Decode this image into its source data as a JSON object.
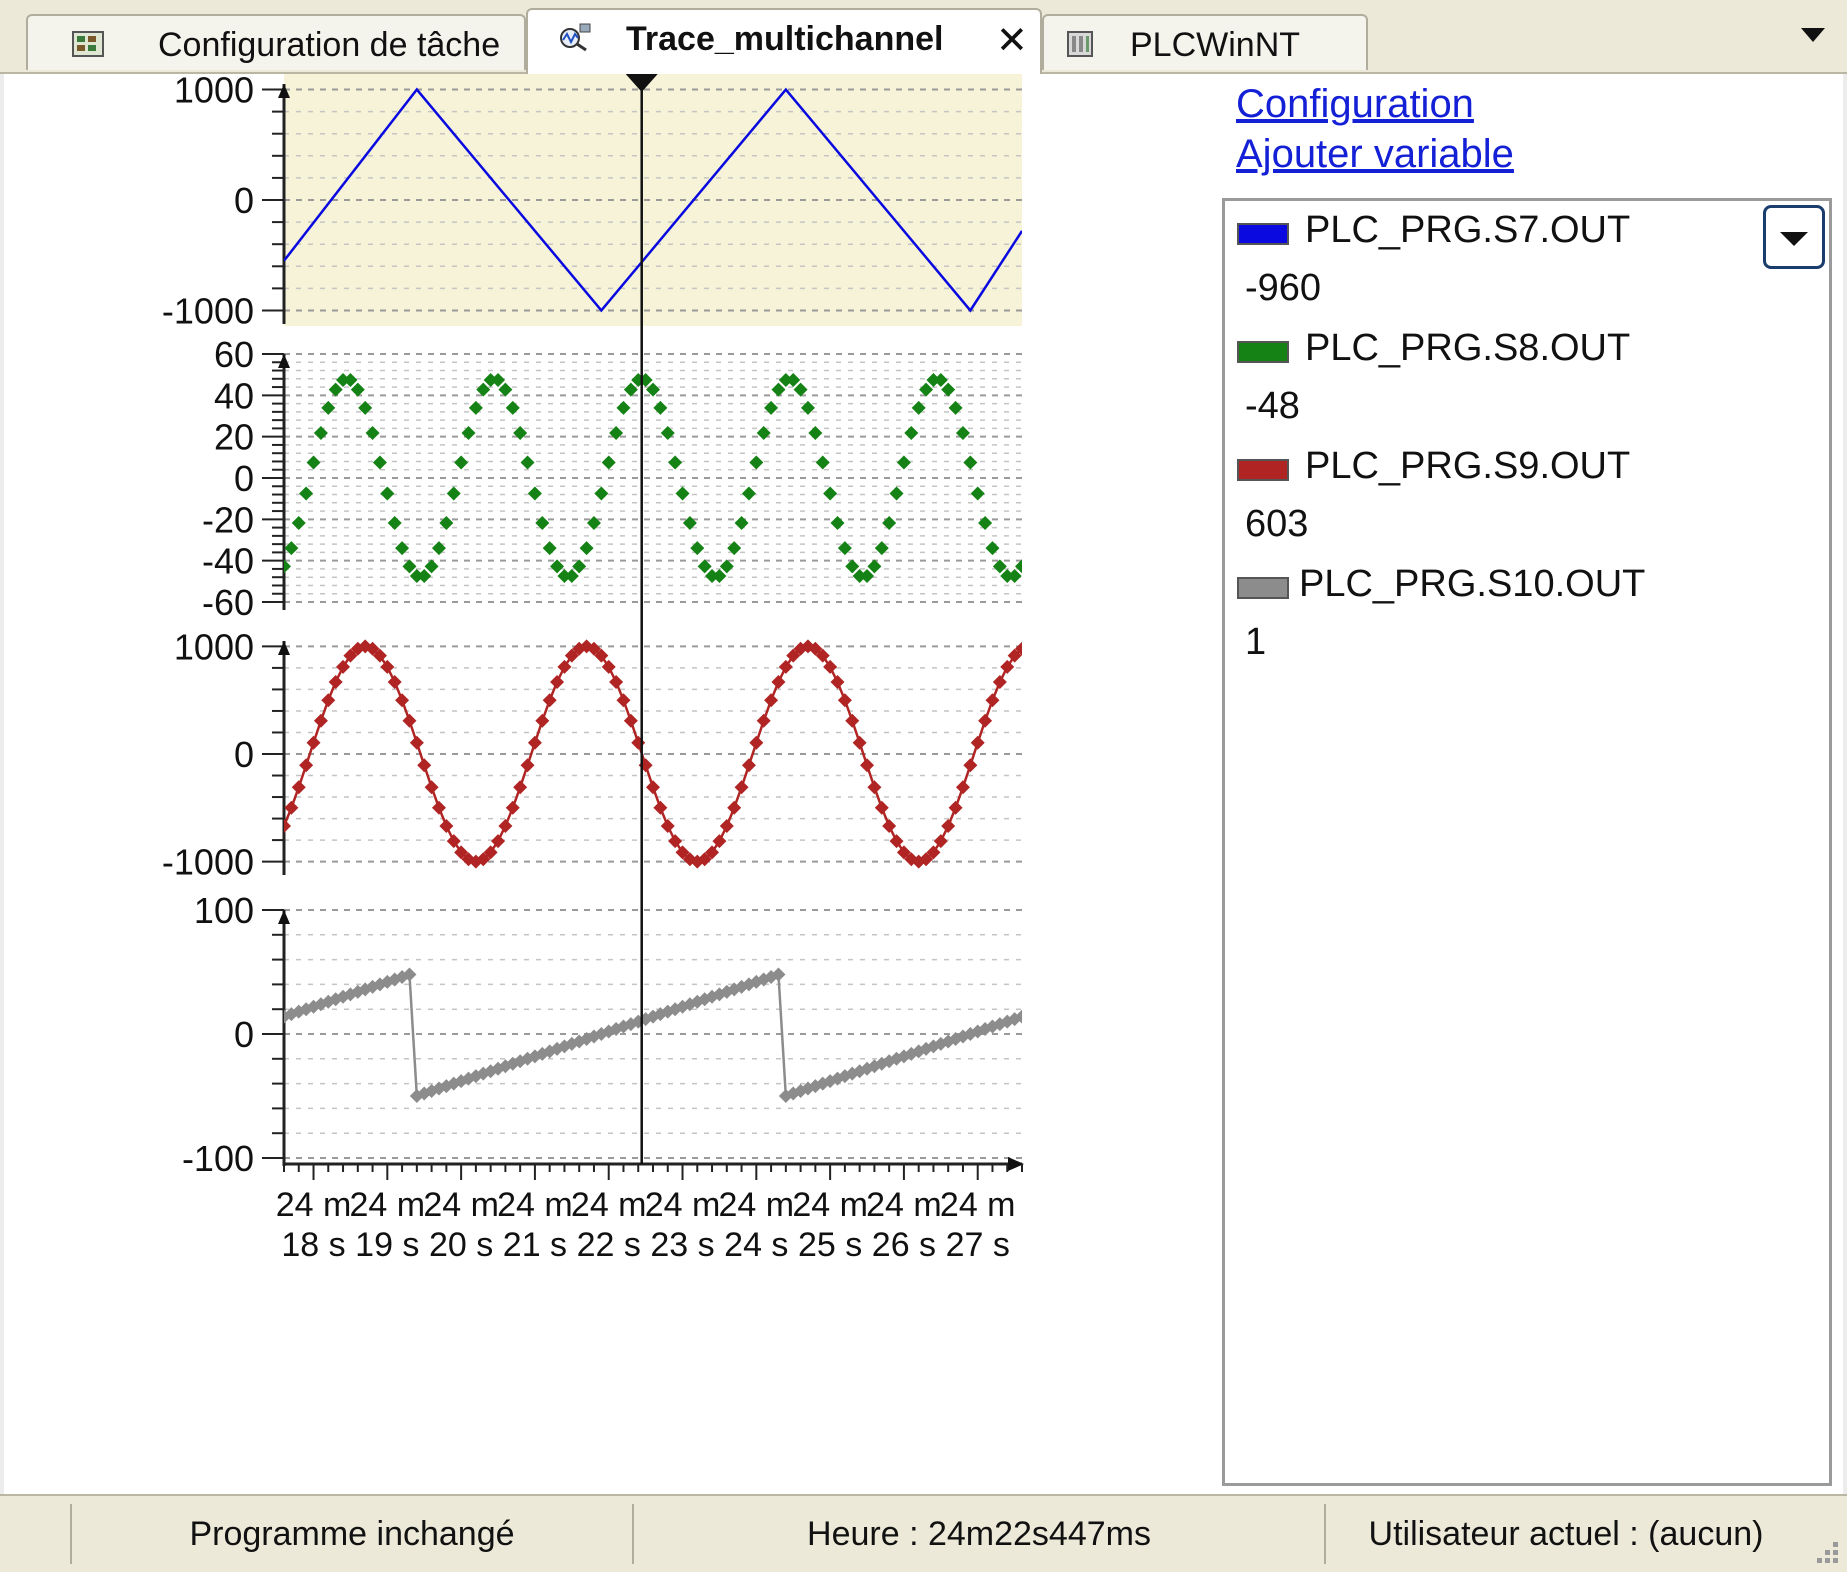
{
  "tabs": [
    {
      "label": "Configuration de tâche",
      "icon": "task-config-icon",
      "active": false
    },
    {
      "label": "Trace_multichannel",
      "icon": "trace-icon",
      "active": true
    },
    {
      "label": "PLCWinNT",
      "icon": "plc-device-icon",
      "active": false
    }
  ],
  "links": {
    "configuration": "Configuration",
    "add_variable": "Ajouter variable"
  },
  "legend": [
    {
      "name": "PLC_PRG.S7.OUT",
      "value": "-960",
      "color": "#0a0ae0"
    },
    {
      "name": "PLC_PRG.S8.OUT",
      "value": "-48",
      "color": "#148214"
    },
    {
      "name": "PLC_PRG.S9.OUT",
      "value": "603",
      "color": "#b02424"
    },
    {
      "name": "PLC_PRG.S10.OUT",
      "value": "1",
      "color": "#8c8c8c"
    }
  ],
  "status": {
    "program": "Programme inchangé",
    "time": "Heure : 24m22s447ms",
    "user": "Utilisateur actuel : (aucun)"
  },
  "chart_data": {
    "type": "line",
    "x_tick_labels": [
      [
        "24 m",
        "18 s"
      ],
      [
        "24 m",
        "19 s"
      ],
      [
        "24 m",
        "20 s"
      ],
      [
        "24 m",
        "21 s"
      ],
      [
        "24 m",
        "22 s"
      ],
      [
        "24 m",
        "23 s"
      ],
      [
        "24 m",
        "24 s"
      ],
      [
        "24 m",
        "25 s"
      ],
      [
        "24 m",
        "26 s"
      ],
      [
        "24 m",
        "27 s"
      ]
    ],
    "x_range_s": [
      17.6,
      27.6
    ],
    "cursor_s": 22.447,
    "panels": [
      {
        "series": "PLC_PRG.S7.OUT",
        "color": "#0a0ae0",
        "style": "line",
        "background": "#f6f3d8",
        "yticks": [
          "1000",
          "0",
          "-1000"
        ],
        "ylim": [
          -1050,
          1050
        ],
        "points": [
          [
            17.6,
            -550
          ],
          [
            19.4,
            1000
          ],
          [
            21.9,
            -1000
          ],
          [
            24.4,
            1000
          ],
          [
            26.9,
            -1000
          ],
          [
            27.6,
            -280
          ]
        ]
      },
      {
        "series": "PLC_PRG.S8.OUT",
        "color": "#148214",
        "style": "markers",
        "yticks": [
          "60",
          "40",
          "20",
          "0",
          "-20",
          "-40",
          "-60"
        ],
        "ylim": [
          -60,
          60
        ],
        "wave": "sine",
        "amplitude": 48,
        "period_s": 2.0,
        "phase_s": 18.45,
        "sample_s": 0.1
      },
      {
        "series": "PLC_PRG.S9.OUT",
        "color": "#b02424",
        "style": "line+markers",
        "yticks": [
          "1000",
          "0",
          "-1000"
        ],
        "ylim": [
          -1050,
          1050
        ],
        "wave": "sine",
        "amplitude": 1000,
        "period_s": 3.0,
        "phase_s": 18.7,
        "sample_s": 0.1
      },
      {
        "series": "PLC_PRG.S10.OUT",
        "color": "#8c8c8c",
        "style": "line+markers",
        "yticks": [
          "100",
          "0",
          "-100"
        ],
        "ylim": [
          -100,
          100
        ],
        "wave": "sawtooth",
        "low": -50,
        "high": 50,
        "period_s": 5.0,
        "reset_s": 19.4,
        "sample_s": 0.1
      }
    ]
  }
}
